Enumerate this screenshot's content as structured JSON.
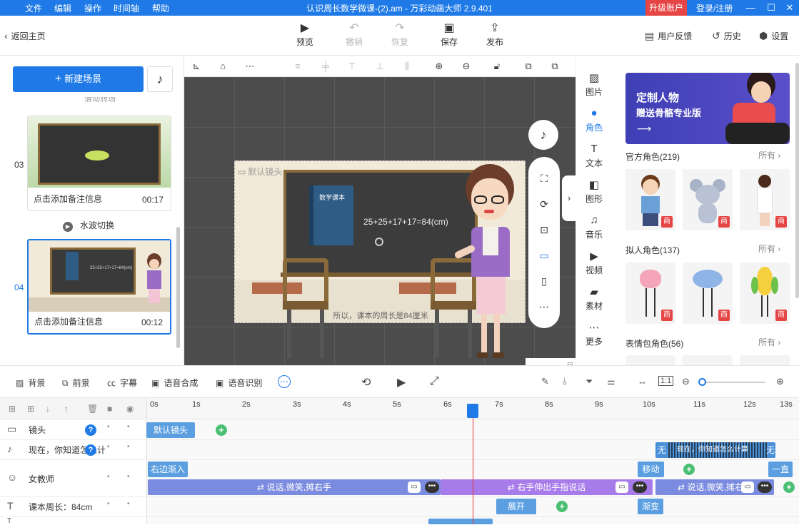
{
  "titlebar": {
    "menus": [
      "文件",
      "编辑",
      "操作",
      "时间轴",
      "帮助"
    ],
    "title": "认识周长数学微课-(2).am - 万彩动画大师 2.9.401",
    "upgrade": "升级账户",
    "login": "登录/注册"
  },
  "toolbar": {
    "back": "返回主页",
    "preview": "预览",
    "undo": "撤销",
    "redo": "恢复",
    "save": "保存",
    "publish": "发布",
    "feedback": "用户反馈",
    "history": "历史",
    "settings": "设置"
  },
  "scenes": {
    "new_scene": "新建场景",
    "partial_label": "滑动转场",
    "items": [
      {
        "num": "03",
        "note": "点击添加备注信息",
        "duration": "00:17"
      },
      {
        "num": "04",
        "note": "点击添加备注信息",
        "duration": "00:12"
      }
    ],
    "transition": "水波切换"
  },
  "stage": {
    "label": "默认镜头",
    "formula": "25+25+17+17=84(cm)",
    "book_title": "数学课本",
    "subtitle": "所以，课本的周长是84厘米"
  },
  "rightnav": {
    "items": [
      "图片",
      "角色",
      "文本",
      "图形",
      "音乐",
      "视频",
      "素材",
      "更多"
    ]
  },
  "rightpanel": {
    "banner_line1": "定制人物",
    "banner_line2": "赠送骨骼专业版",
    "categories": [
      {
        "name": "官方角色(219)",
        "more": "所有"
      },
      {
        "name": "拟人角色(137)",
        "more": "所有"
      },
      {
        "name": "表情包角色(56)",
        "more": "所有"
      }
    ],
    "badge": "商"
  },
  "timeline_toolbar": {
    "background": "背景",
    "foreground": "前景",
    "captions": "字幕",
    "tts": "语音合成",
    "asr": "语音识别"
  },
  "ruler": [
    "0s",
    "1s",
    "2s",
    "3s",
    "4s",
    "5s",
    "6s",
    "7s",
    "8s",
    "9s",
    "10s",
    "11s",
    "12s",
    "13s"
  ],
  "tracks": {
    "camera": {
      "name": "镜头",
      "block": "默认镜头"
    },
    "music": {
      "name": "现在，你知道怎么计",
      "block_left": "无",
      "block_text": "现在，你知道怎么计算",
      "block_right": "无"
    },
    "teacher": {
      "name": "女教师",
      "enter": "右边渐入",
      "move": "移动",
      "straight": "一直",
      "actions": [
        "说话,微笑,摊右手",
        "右手伸出手指说话",
        "说话,微笑,摊右手"
      ]
    },
    "text": {
      "name": "课本周长：84cm",
      "expand": "展开",
      "fade": "渐变"
    }
  },
  "colors": {
    "accent": "#1f7ae8",
    "upgrade": "#e64545",
    "plus": "#4bbf73"
  }
}
